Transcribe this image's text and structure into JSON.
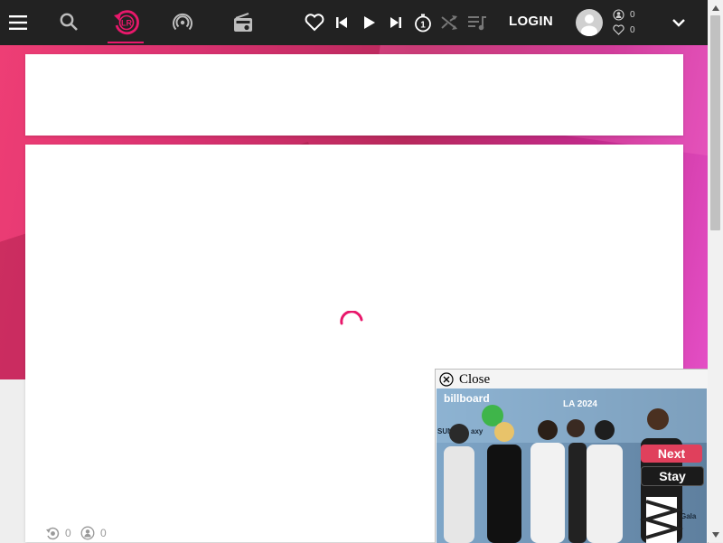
{
  "topbar": {
    "login_label": "LOGIN",
    "logo_letters": "LR",
    "stats": {
      "listeners": "0",
      "likes": "0"
    }
  },
  "content": {
    "bottom_stats": {
      "rotation": "0",
      "listeners": "0"
    }
  },
  "popup": {
    "close_label": "Close",
    "next_label": "Next",
    "stay_label": "Stay",
    "video_text": {
      "brand": "billboard",
      "event": "LA 2024",
      "sponsor_left": "SUN",
      "sponsor_left2": "axy",
      "sponsor_right": "Gala"
    }
  },
  "colors": {
    "accent": "#e8186b",
    "topbar_bg": "#222222",
    "next_btn": "#e0405c",
    "stay_btn": "#1b1b1b"
  },
  "icons": [
    "menu-icon",
    "search-icon",
    "logo-icon",
    "podcast-icon",
    "radio-icon",
    "heart-icon",
    "skip-previous-icon",
    "play-icon",
    "skip-next-icon",
    "timer-icon",
    "shuffle-icon",
    "playlist-icon",
    "account-icon",
    "chevron-down-icon"
  ]
}
